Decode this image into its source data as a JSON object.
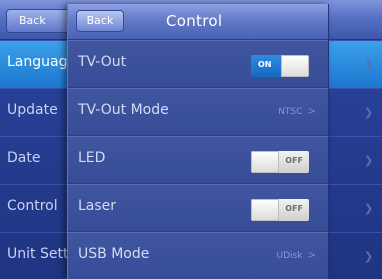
{
  "background_screen": {
    "back_label": "Back",
    "rows": [
      {
        "label": "Language",
        "selected": true
      },
      {
        "label": "Update",
        "selected": false
      },
      {
        "label": "Date",
        "selected": false
      },
      {
        "label": "Control",
        "selected": false
      },
      {
        "label": "Unit Setting",
        "selected": false
      }
    ],
    "chevron_icon": "chevron-right-icon"
  },
  "panel": {
    "back_label": "Back",
    "title": "Control",
    "rows": [
      {
        "label": "TV-Out",
        "toggle": "on",
        "toggle_label": "ON"
      },
      {
        "label": "TV-Out Mode",
        "value": "NTSC"
      },
      {
        "label": "LED",
        "toggle": "off",
        "toggle_label": "OFF"
      },
      {
        "label": "Laser",
        "toggle": "off",
        "toggle_label": "OFF"
      },
      {
        "label": "USB Mode",
        "value": "UDisk"
      }
    ]
  },
  "colors": {
    "accent_blue": "#2d8ce4",
    "panel_bg": "#3a4f9c",
    "header_bg": "#6077c6"
  }
}
